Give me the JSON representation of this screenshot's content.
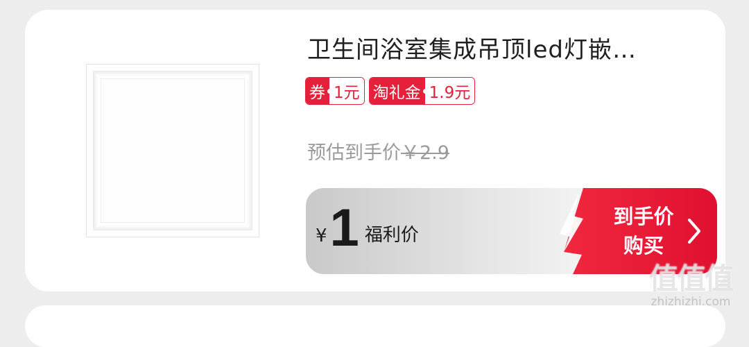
{
  "product": {
    "title": "卫生间浴室集成吊顶led灯嵌…",
    "coupon": {
      "label": "券",
      "value": "1元"
    },
    "gift": {
      "label": "淘礼金",
      "value": "1.9元"
    },
    "estimate": {
      "label": "预估到手价",
      "price": "￥2.9"
    },
    "deal": {
      "currency": "¥",
      "price": "1",
      "price_label": "福利价"
    },
    "buy_button": {
      "line1": "到手价",
      "line2": "购买"
    }
  },
  "watermark": {
    "glyphs": "值值值",
    "url": "zhizhizhi.com"
  },
  "colors": {
    "accent_red": "#e5203a",
    "card_bg": "#ffffff",
    "page_bg": "#ededed"
  },
  "icons": {
    "buy_chevron": "chevron-right-icon",
    "thumbnail": "ceiling-panel-image"
  }
}
